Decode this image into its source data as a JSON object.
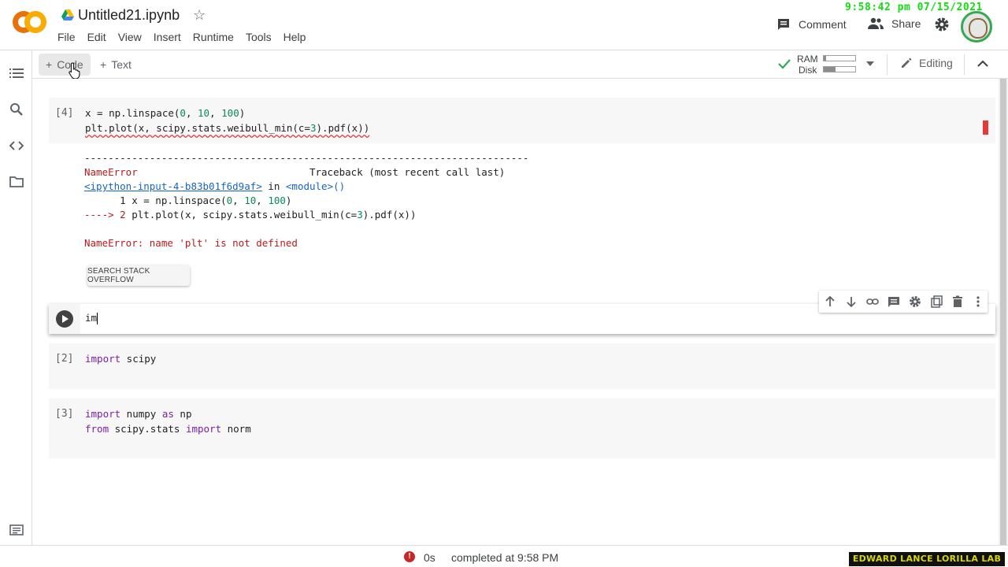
{
  "app": {
    "notebook_title": "Untitled21.ipynb",
    "clock": "9:58:42 pm 07/15/2021"
  },
  "menu": [
    "File",
    "Edit",
    "View",
    "Insert",
    "Runtime",
    "Tools",
    "Help"
  ],
  "header_actions": {
    "comment_label": "Comment",
    "share_label": "Share"
  },
  "toolbar": {
    "add_code_label": "Code",
    "add_text_label": "Text",
    "ram_label": "RAM",
    "disk_label": "Disk",
    "ram_usage_fraction": 0.08,
    "disk_usage_fraction": 0.38,
    "editing_label": "Editing",
    "connected_color": "#34a853"
  },
  "cells": {
    "cell4": {
      "exec_count": "[4]",
      "line1_a": "x = np.linspace(",
      "line1_n1": "0",
      "line1_b": ", ",
      "line1_n2": "10",
      "line1_c": ", ",
      "line1_n3": "100",
      "line1_d": ")",
      "line2_a": "plt.plot(x, scipy.stats.weibull_min(c=",
      "line2_n": "3",
      "line2_b": ").pdf(x))"
    },
    "output": {
      "dashes": "---------------------------------------------------------------------------",
      "error_name": "NameError",
      "traceback_label": "                             Traceback (most recent call last)",
      "input_link": "<ipython-input-4-b83b01f6d9af>",
      "in_text": " in ",
      "module_text": "<module>()",
      "tb_line1_a": "      1 x = np.linspace(",
      "tb_line1_n1": "0",
      "tb_line1_b": ", ",
      "tb_line1_n2": "10",
      "tb_line1_c": ", ",
      "tb_line1_n3": "100",
      "tb_line1_d": ")",
      "tb_arrow": "----> 2 ",
      "tb_line2_a": "plt.plot(x, scipy.stats.weibull_min(c=",
      "tb_line2_n": "3",
      "tb_line2_b": ").pdf(x))",
      "error_message": "NameError: name 'plt' is not defined",
      "search_button": "SEARCH STACK OVERFLOW"
    },
    "active": {
      "code": "im"
    },
    "cell2": {
      "exec_count": "[2]",
      "kw": "import",
      "rest": " scipy"
    },
    "cell3": {
      "exec_count": "[3]",
      "l1_kw": "import",
      "l1_mid": " numpy ",
      "l1_kw2": "as",
      "l1_rest": " np",
      "l2_kw": "from",
      "l2_mid": " scipy.stats ",
      "l2_kw2": "import",
      "l2_rest": " norm"
    }
  },
  "statusbar": {
    "error_glyph": "!",
    "duration": "0s",
    "completed": "completed at 9:58 PM"
  },
  "watermark": "EDWARD LANCE LORILLA LAB",
  "icons": {
    "drive": "google-drive-icon",
    "star": "star-icon",
    "comment": "comment-icon",
    "share": "people-icon",
    "settings": "gear-icon",
    "toc": "table-of-contents-icon",
    "search": "search-icon",
    "code_snippets": "code-icon",
    "files": "folder-icon",
    "terminal": "terminal-icon"
  }
}
